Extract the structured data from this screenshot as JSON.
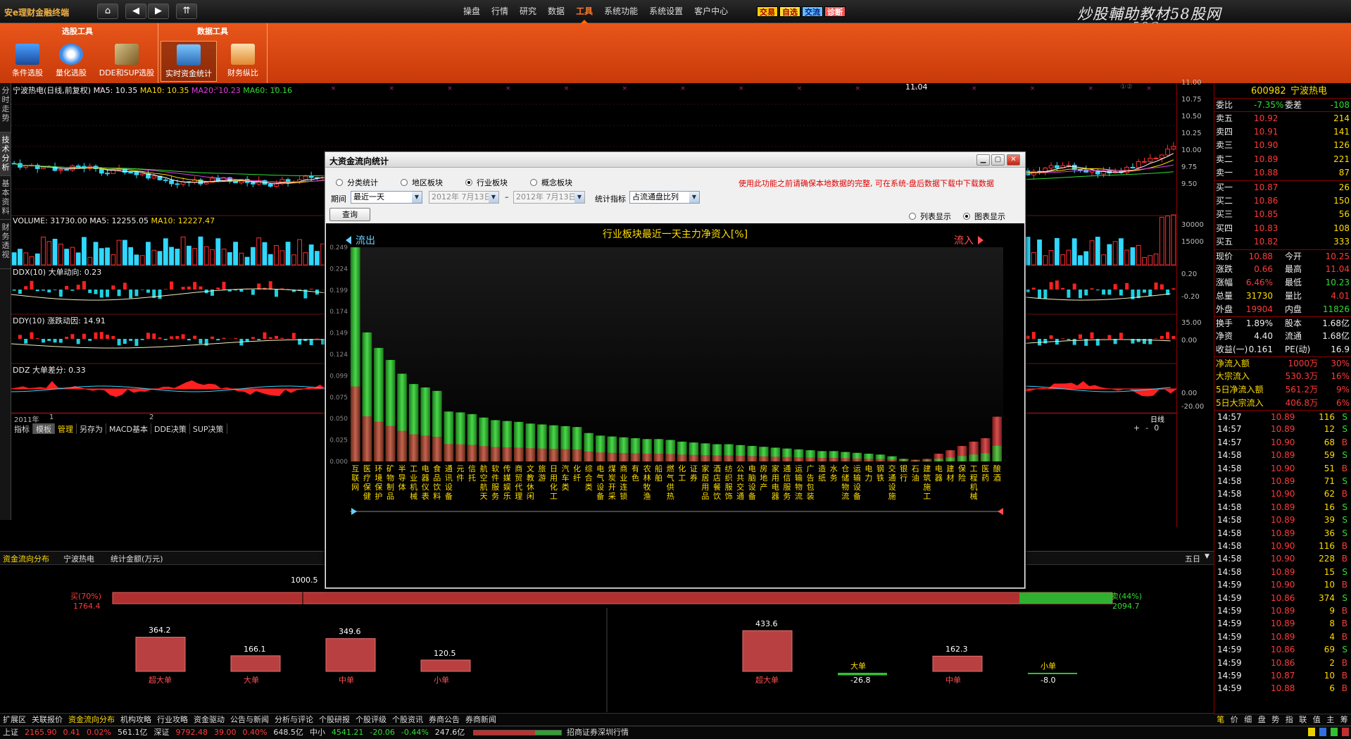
{
  "app": {
    "title": "安e理财金融终端"
  },
  "nav": {
    "home": "⌂",
    "back": "◀",
    "forward": "▶",
    "up": "⇈"
  },
  "menu": [
    "操盘",
    "行情",
    "研究",
    "数据",
    "工具",
    "系统功能",
    "系统设置",
    "客户中心"
  ],
  "menu_active": "工具",
  "badges": [
    {
      "label": "交易",
      "bg": "#ffcc00",
      "fg": "#a00000"
    },
    {
      "label": "自选",
      "bg": "#ffdd33",
      "fg": "#a00000"
    },
    {
      "label": "交流",
      "bg": "#66bbff",
      "fg": "#002288"
    },
    {
      "label": "诊断",
      "bg": "#ff5555",
      "fg": "#ffffff"
    }
  ],
  "brand": {
    "line1": "炒股輔助教材58股网",
    "line2": "www.58Gu.com"
  },
  "toolbar": {
    "group1": "选股工具",
    "group2": "数据工具",
    "tools": [
      "条件选股",
      "量化选股",
      "DDE和SUP选股",
      "实时资金统计",
      "财务纵比"
    ]
  },
  "vtabs": [
    "分时走势",
    "技术分析",
    "基本资料",
    "财务透视"
  ],
  "kline": {
    "title": "宁波热电(日线,前复权)",
    "ma5": "MA5: 10.35",
    "ma10": "MA10: 10.35",
    "ma20": "MA20: 10.23",
    "ma60": "MA60: 10.16",
    "yaxis": [
      "11.00",
      "10.75",
      "10.50",
      "10.25",
      "10.00",
      "9.75",
      "9.50"
    ],
    "peak": "11.04",
    "circle": "①②"
  },
  "volume": {
    "label": "VOLUME: 31730.00",
    "ma5": "MA5: 12255.05",
    "ma10": "MA10: 12227.47",
    "yaxis": [
      "30000",
      "15000"
    ]
  },
  "ddx": {
    "label": "DDX(10)",
    "sub": "大单动向: 0.23",
    "yaxis": [
      "0.20",
      "-0.20"
    ]
  },
  "ddy": {
    "label": "DDY(10)",
    "sub": "涨跌动因: 14.91",
    "yaxis": [
      "35.00",
      "0.00"
    ]
  },
  "ddz": {
    "label": "DDZ",
    "sub": "大单差分: 0.33",
    "yaxis": [
      "0.00",
      "-20.00"
    ]
  },
  "xaxis": {
    "year": "2011年",
    "m1": "1",
    "m2": "2",
    "m7": "7",
    "right": "日线"
  },
  "subtabs": [
    "指标",
    "模板",
    "管理",
    "另存为",
    "MACD基本",
    "DDE决策",
    "SUP决策"
  ],
  "zoom": [
    "+",
    "-",
    "0"
  ],
  "flow": {
    "tab": "资金流向分布",
    "stock": "宁波热电",
    "unit": "统计金额(万元)",
    "period": "五日",
    "buy_label": "买(70%)",
    "buy_value": "1764.4",
    "sell_label": "卖(44%)",
    "sell_value": "2094.7",
    "mid": "1000.5",
    "buy": [
      {
        "cat": "超大单",
        "val": "364.2",
        "n": 364.2
      },
      {
        "cat": "大单",
        "val": "166.1",
        "n": 166.1
      },
      {
        "cat": "中单",
        "val": "349.6",
        "n": 349.6
      },
      {
        "cat": "小单",
        "val": "120.5",
        "n": 120.5
      }
    ],
    "sell": [
      {
        "cat": "超大单",
        "val": "433.6",
        "n": 433.6
      },
      {
        "cat": "大单",
        "val": "-26.8",
        "n": -26.8
      },
      {
        "cat": "中单",
        "val": "162.3",
        "n": 162.3
      },
      {
        "cat": "小单",
        "val": "-8.0",
        "n": -8.0
      }
    ]
  },
  "navtabs": [
    "扩展区",
    "关联报价",
    "资金流向分布",
    "机构攻略",
    "行业攻略",
    "资金驱动",
    "公告与新闻",
    "分析与评论",
    "个股研报",
    "个股评级",
    "个股资讯",
    "券商公告",
    "券商新闻"
  ],
  "navtab_active": "资金流向分布",
  "status": [
    {
      "t": "上证",
      "c": "#ddd"
    },
    {
      "t": "2165.90",
      "c": "#ff3a3a"
    },
    {
      "t": "0.41",
      "c": "#ff3a3a"
    },
    {
      "t": "0.02%",
      "c": "#ff3a3a"
    },
    {
      "t": "561.1亿",
      "c": "#ddd"
    },
    {
      "t": "深证",
      "c": "#ddd"
    },
    {
      "t": "9792.48",
      "c": "#ff3a3a"
    },
    {
      "t": "39.00",
      "c": "#ff3a3a"
    },
    {
      "t": "0.40%",
      "c": "#ff3a3a"
    },
    {
      "t": "648.5亿",
      "c": "#ddd"
    },
    {
      "t": "中小",
      "c": "#ddd"
    },
    {
      "t": "4541.21",
      "c": "#33dd33"
    },
    {
      "t": "-20.06",
      "c": "#33dd33"
    },
    {
      "t": "-0.44%",
      "c": "#33dd33"
    },
    {
      "t": "247.6亿",
      "c": "#ddd"
    }
  ],
  "status_right": "招商证券深圳行情",
  "quote": {
    "code": "600982",
    "name": "宁波热电",
    "weibi": "委比",
    "weibi_val": "-7.35%",
    "weicha": "委差",
    "weicha_val": "-108",
    "asks": [
      {
        "l": "卖五",
        "p": "10.92",
        "v": "214"
      },
      {
        "l": "卖四",
        "p": "10.91",
        "v": "141"
      },
      {
        "l": "卖三",
        "p": "10.90",
        "v": "126"
      },
      {
        "l": "卖二",
        "p": "10.89",
        "v": "221"
      },
      {
        "l": "卖一",
        "p": "10.88",
        "v": "87"
      }
    ],
    "bids": [
      {
        "l": "买一",
        "p": "10.87",
        "v": "26"
      },
      {
        "l": "买二",
        "p": "10.86",
        "v": "150"
      },
      {
        "l": "买三",
        "p": "10.85",
        "v": "56"
      },
      {
        "l": "买四",
        "p": "10.83",
        "v": "108"
      },
      {
        "l": "买五",
        "p": "10.82",
        "v": "333"
      }
    ],
    "stats": [
      {
        "a": "现价",
        "av": "10.88",
        "ac": "red",
        "b": "今开",
        "bv": "10.25",
        "bc": "red"
      },
      {
        "a": "涨跌",
        "av": "0.66",
        "ac": "red",
        "b": "最高",
        "bv": "11.04",
        "bc": "red"
      },
      {
        "a": "涨幅",
        "av": "6.46%",
        "ac": "red",
        "b": "最低",
        "bv": "10.23",
        "bc": "grn"
      },
      {
        "a": "总量",
        "av": "31730",
        "ac": "yel",
        "b": "量比",
        "bv": "4.01",
        "bc": "red"
      },
      {
        "a": "外盘",
        "av": "19904",
        "ac": "red",
        "b": "内盘",
        "bv": "11826",
        "bc": "grn"
      }
    ],
    "stats2": [
      {
        "a": "换手",
        "av": "1.89%",
        "b": "股本",
        "bv": "1.68亿"
      },
      {
        "a": "净资",
        "av": "4.40",
        "b": "流通",
        "bv": "1.68亿"
      },
      {
        "a": "收益(一)",
        "av": "0.161",
        "b": "PE(动)",
        "bv": "16.9"
      }
    ],
    "flows": [
      {
        "a": "净流入额",
        "b": "1000万",
        "c": "30%"
      },
      {
        "a": "大宗流入",
        "b": "530.3万",
        "c": "16%"
      },
      {
        "a": "5日净流入额",
        "b": "561.2万",
        "c": "9%"
      },
      {
        "a": "5日大宗流入",
        "b": "406.8万",
        "c": "6%"
      }
    ],
    "ticks": [
      [
        "14:57",
        "10.89",
        "116",
        "S"
      ],
      [
        "14:57",
        "10.89",
        "12",
        "S"
      ],
      [
        "14:57",
        "10.90",
        "68",
        "B"
      ],
      [
        "14:58",
        "10.89",
        "59",
        "S"
      ],
      [
        "14:58",
        "10.90",
        "51",
        "B"
      ],
      [
        "14:58",
        "10.89",
        "71",
        "S"
      ],
      [
        "14:58",
        "10.90",
        "62",
        "B"
      ],
      [
        "14:58",
        "10.89",
        "16",
        "S"
      ],
      [
        "14:58",
        "10.89",
        "39",
        "S"
      ],
      [
        "14:58",
        "10.89",
        "36",
        "S"
      ],
      [
        "14:58",
        "10.90",
        "116",
        "B"
      ],
      [
        "14:58",
        "10.90",
        "228",
        "B"
      ],
      [
        "14:58",
        "10.89",
        "15",
        "S"
      ],
      [
        "14:59",
        "10.90",
        "10",
        "B"
      ],
      [
        "14:59",
        "10.86",
        "374",
        "S"
      ],
      [
        "14:59",
        "10.89",
        "9",
        "B"
      ],
      [
        "14:59",
        "10.89",
        "8",
        "B"
      ],
      [
        "14:59",
        "10.89",
        "4",
        "B"
      ],
      [
        "14:59",
        "10.86",
        "69",
        "S"
      ],
      [
        "14:59",
        "10.86",
        "2",
        "B"
      ],
      [
        "14:59",
        "10.87",
        "10",
        "B"
      ],
      [
        "14:59",
        "10.88",
        "6",
        "B"
      ]
    ],
    "bottomtabs": [
      "笔",
      "价",
      "细",
      "盘",
      "势",
      "指",
      "联",
      "值",
      "主",
      "筹"
    ]
  },
  "dialog": {
    "title": "大资金流向统计",
    "radios": [
      "分类统计",
      "地区板块",
      "行业板块",
      "概念板块"
    ],
    "radio_sel": 2,
    "warning": "使用此功能之前请确保本地数据的完整, 可在系统-盘后数据下载中下载数据",
    "period_label": "期间",
    "period_value": "最近一天",
    "date1": "2012年 7月13日",
    "date2": "2012年 7月13日",
    "dash": "–",
    "metric_label": "统计指标",
    "metric_value": "占流通盘比列",
    "query": "查询",
    "view_list": "列表显示",
    "view_chart": "图表显示",
    "view_sel": 1
  },
  "chart_data": {
    "type": "bar",
    "title": "行业板块最近一天主力净资入[%]",
    "outflow_label": "流出",
    "inflow_label": "流入",
    "ylim": [
      0,
      0.249
    ],
    "yticks": [
      "0.249",
      "0.224",
      "0.199",
      "0.174",
      "0.149",
      "0.124",
      "0.099",
      "0.075",
      "0.050",
      "0.025",
      "0.000"
    ],
    "categories": [
      "互联网",
      "医疗保健",
      "环境保护",
      "矿物制品",
      "半导体",
      "工业机械",
      "电器仪表",
      "食品饮料",
      "通讯设备",
      "元件",
      "信托",
      "航空航天",
      "软件服务",
      "传媒娱乐",
      "商贸代理",
      "文教休闲",
      "旅游",
      "日用化工",
      "汽车类",
      "化纤",
      "综合类",
      "电气设备",
      "煤炭开采",
      "商业连锁",
      "有色",
      "农林牧渔",
      "船舶",
      "燃气供热",
      "化工",
      "证券",
      "家居用品",
      "酒店餐饮",
      "纺织服饰",
      "公共交通",
      "电脑设备",
      "房地产",
      "家用电器",
      "通信服务",
      "运输物流",
      "广告包装",
      "造纸",
      "水务",
      "仓储物流",
      "运输设备",
      "电力",
      "钢铁",
      "交通设施",
      "银行",
      "石油",
      "建筑施工",
      "电器",
      "建材",
      "保险",
      "工程机械",
      "医药",
      "酿酒"
    ],
    "series": [
      {
        "values": [
          0.249,
          0.15,
          0.132,
          0.118,
          0.102,
          0.09,
          0.086,
          0.082,
          0.058,
          0.057,
          0.055,
          0.051,
          0.048,
          0.047,
          0.046,
          0.044,
          0.043,
          0.042,
          0.041,
          0.04,
          0.033,
          0.03,
          0.029,
          0.028,
          0.027,
          0.026,
          0.026,
          0.025,
          0.023,
          0.022,
          0.021,
          0.02,
          0.02,
          0.019,
          0.018,
          0.017,
          0.016,
          0.015,
          0.014,
          0.013,
          0.012,
          0.012,
          0.011,
          0.01,
          0.009,
          0.008,
          0.006,
          0.003,
          0.002,
          0.003,
          0.009,
          0.013,
          0.018,
          0.023,
          0.027,
          0.052
        ]
      }
    ]
  }
}
